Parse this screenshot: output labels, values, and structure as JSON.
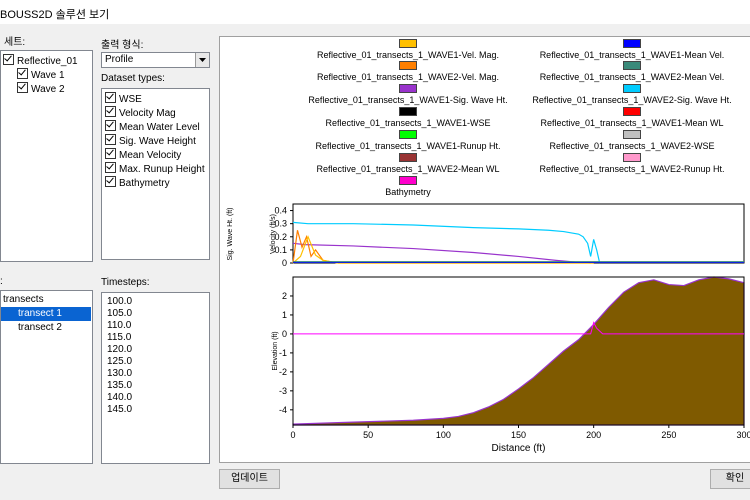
{
  "window": {
    "title": "BOUSS2D 솔루션 보기"
  },
  "datasets": {
    "label": "세트:",
    "items": [
      {
        "label": "Reflective_01",
        "checked": true
      },
      {
        "label": "Wave 1",
        "checked": true
      },
      {
        "label": "Wave 2",
        "checked": true
      }
    ]
  },
  "output_format": {
    "label": "출력 형식:",
    "value": "Profile"
  },
  "dataset_types": {
    "label": "Dataset types:",
    "items": [
      {
        "label": "WSE",
        "checked": true
      },
      {
        "label": "Velocity Mag",
        "checked": true
      },
      {
        "label": "Mean Water Level",
        "checked": true
      },
      {
        "label": "Sig. Wave Height",
        "checked": true
      },
      {
        "label": "Mean Velocity",
        "checked": true
      },
      {
        "label": "Max. Runup Height",
        "checked": true
      },
      {
        "label": "Bathymetry",
        "checked": true
      }
    ]
  },
  "transects": {
    "label": ":",
    "items": [
      {
        "label": "transects"
      },
      {
        "label": "transect 1",
        "selected": true
      },
      {
        "label": "transect 2"
      }
    ]
  },
  "timesteps": {
    "label": "Timesteps:",
    "items": [
      "100.0",
      "105.0",
      "110.0",
      "115.0",
      "120.0",
      "125.0",
      "130.0",
      "135.0",
      "140.0",
      "145.0"
    ]
  },
  "legend": [
    {
      "label": "Reflective_01_transects_1_WAVE1-Vel. Mag.",
      "color": "#ffc000"
    },
    {
      "label": "Reflective_01_transects_1_WAVE1-Mean Vel.",
      "color": "#0000ff"
    },
    {
      "label": "Reflective_01_transects_1_WAVE2-Vel. Mag.",
      "color": "#ff7f00"
    },
    {
      "label": "Reflective_01_transects_1_WAVE2-Mean Vel.",
      "color": "#3a8a7a"
    },
    {
      "label": "Reflective_01_transects_1_WAVE1-Sig. Wave Ht.",
      "color": "#9933cc"
    },
    {
      "label": "Reflective_01_transects_1_WAVE2-Sig. Wave Ht.",
      "color": "#00ccff"
    },
    {
      "label": "Reflective_01_transects_1_WAVE1-WSE",
      "color": "#000000"
    },
    {
      "label": "Reflective_01_transects_1_WAVE1-Mean WL",
      "color": "#ff0000"
    },
    {
      "label": "Reflective_01_transects_1_WAVE1-Runup Ht.",
      "color": "#00ff00"
    },
    {
      "label": "Reflective_01_transects_1_WAVE2-WSE",
      "color": "#c0c0c0"
    },
    {
      "label": "Reflective_01_transects_1_WAVE2-Mean WL",
      "color": "#993333"
    },
    {
      "label": "Reflective_01_transects_1_WAVE2-Runup Ht.",
      "color": "#ff99cc"
    },
    {
      "label": "Bathymetry",
      "color": "#ff00cc"
    }
  ],
  "chart_data": [
    {
      "type": "line",
      "ylabel_left": "Sig. Wave Ht. (ft)",
      "ylabel_right": "Velocity (ft/s)",
      "yticks": [
        "0.4",
        "0.3",
        "0.2",
        "0.1",
        "0"
      ],
      "ylim": [
        0,
        0.45
      ],
      "xlim": [
        0,
        300
      ],
      "series": [
        {
          "color": "#00ccff",
          "x": [
            0,
            10,
            40,
            80,
            120,
            150,
            170,
            180,
            190,
            193,
            196,
            198,
            200,
            202,
            204
          ],
          "y": [
            0.31,
            0.3,
            0.3,
            0.29,
            0.27,
            0.26,
            0.25,
            0.24,
            0.22,
            0.2,
            0.15,
            0.05,
            0.18,
            0.1,
            0.0
          ]
        },
        {
          "color": "#9933cc",
          "x": [
            0,
            8,
            40,
            80,
            120,
            150,
            175,
            190,
            198
          ],
          "y": [
            0.15,
            0.14,
            0.13,
            0.11,
            0.08,
            0.05,
            0.02,
            0.005,
            0.0
          ]
        },
        {
          "color": "#ff7f00",
          "x": [
            0,
            3,
            6,
            9,
            12,
            15,
            20,
            25,
            30,
            40,
            60,
            100,
            150,
            200
          ],
          "y": [
            0.0,
            0.25,
            0.12,
            0.2,
            0.05,
            0.1,
            0.02,
            0.01,
            0.0,
            0.0,
            0.0,
            0.0,
            0.0,
            0.0
          ]
        },
        {
          "color": "#ffc000",
          "x": [
            0,
            5,
            10,
            15,
            20,
            25,
            30,
            40,
            60,
            100,
            150,
            200
          ],
          "y": [
            0.0,
            0.05,
            0.2,
            0.06,
            0.02,
            0.01,
            0.0,
            0.0,
            0.0,
            0.0,
            0.0,
            0.0
          ]
        },
        {
          "color": "#0000ff",
          "x": [
            0,
            300
          ],
          "y": [
            0.005,
            0.005
          ]
        },
        {
          "color": "#3a8a7a",
          "x": [
            0,
            300
          ],
          "y": [
            0.01,
            0.01
          ]
        }
      ]
    },
    {
      "type": "area",
      "ylabel": "Elevation (ft)",
      "xlabel": "Distance (ft)",
      "xticks": [
        "0",
        "50",
        "100",
        "150",
        "200",
        "250",
        "300"
      ],
      "yticks": [
        "2",
        "1",
        "0",
        "-1",
        "-2",
        "-3",
        "-4"
      ],
      "xlim": [
        0,
        300
      ],
      "ylim": [
        -4.8,
        3.0
      ],
      "bathymetry": {
        "color": "#7f5a00",
        "x": [
          0,
          20,
          40,
          60,
          80,
          100,
          110,
          120,
          130,
          140,
          150,
          160,
          170,
          180,
          190,
          200,
          210,
          220,
          230,
          240,
          250,
          260,
          270,
          280,
          290,
          300
        ],
        "y": [
          -4.75,
          -4.7,
          -4.65,
          -4.6,
          -4.55,
          -4.45,
          -4.35,
          -4.15,
          -3.85,
          -3.45,
          -2.9,
          -2.3,
          -1.6,
          -0.9,
          -0.3,
          0.5,
          1.4,
          2.2,
          2.7,
          2.85,
          2.6,
          2.55,
          2.85,
          3.0,
          2.9,
          2.7
        ]
      },
      "runup_line": {
        "color": "#ff00ff",
        "x": [
          0,
          198,
          200,
          202,
          206,
          300
        ],
        "y": [
          0.0,
          0.0,
          0.6,
          0.3,
          0.0,
          0.0
        ]
      }
    }
  ],
  "buttons": {
    "update": "업데이트",
    "ok": "확인"
  }
}
